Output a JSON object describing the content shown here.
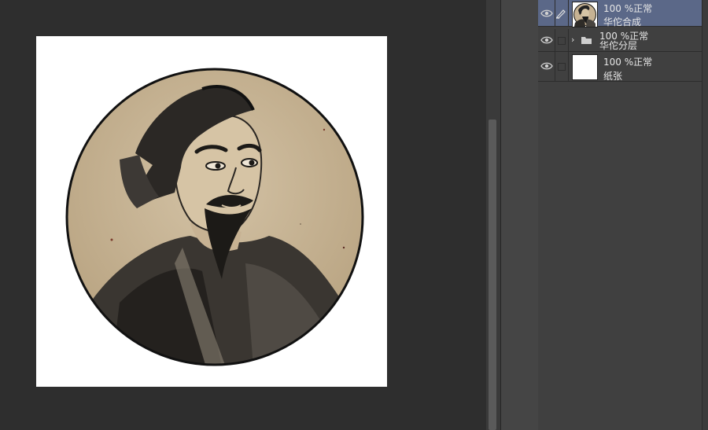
{
  "canvas": {
    "artwork": "ink-portrait-of-hua-tuo",
    "colors": {
      "workspace": "#2e2e2e",
      "paper": "#ffffff",
      "circle_fill": "#cbb89a",
      "ink": "#1c1a17"
    }
  },
  "layers_panel": {
    "selected_color": "#5b6888",
    "layers": [
      {
        "mode": "100 %正常",
        "name": "华佗合成",
        "visible_icon": "eye-icon",
        "selected": true,
        "kind": "raster",
        "thumbnail": "portrait-thumbnail"
      },
      {
        "mode": "100 %正常",
        "name": "华佗分层",
        "visible_icon": "eye-icon",
        "selected": false,
        "kind": "folder",
        "thumbnail": "folder-icon"
      },
      {
        "mode": "100 %正常",
        "name": "纸张",
        "visible_icon": "eye-icon",
        "selected": false,
        "kind": "paper",
        "thumbnail": "blank-thumbnail"
      }
    ]
  }
}
